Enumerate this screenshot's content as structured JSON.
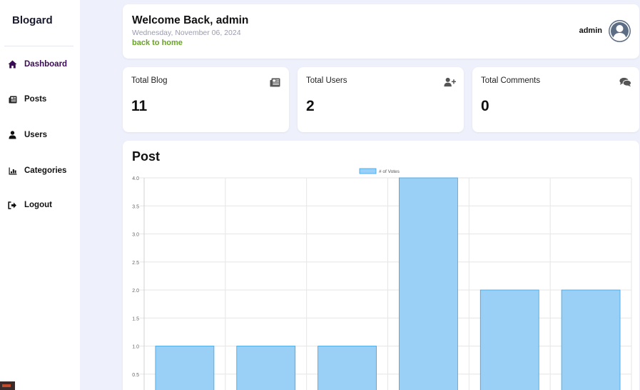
{
  "sidebar": {
    "brand": "Blogard",
    "items": [
      {
        "label": "Dashboard",
        "icon": "home-icon",
        "active": true
      },
      {
        "label": "Posts",
        "icon": "newspaper-icon",
        "active": false
      },
      {
        "label": "Users",
        "icon": "user-icon",
        "active": false
      },
      {
        "label": "Categories",
        "icon": "chart-bar-icon",
        "active": false
      },
      {
        "label": "Logout",
        "icon": "logout-icon",
        "active": false
      }
    ]
  },
  "header": {
    "welcome": "Welcome Back, admin",
    "date": "Wednesday, November 06, 2024",
    "back_link": "back to home",
    "user_name": "admin"
  },
  "stats": [
    {
      "title": "Total Blog",
      "value": "11",
      "icon": "newspaper-icon"
    },
    {
      "title": "Total Users",
      "value": "2",
      "icon": "user-plus-icon"
    },
    {
      "title": "Total Comments",
      "value": "0",
      "icon": "comments-icon"
    }
  ],
  "chart": {
    "title": "Post"
  },
  "colors": {
    "accent": "#3b0a57",
    "link": "#6aa12b",
    "bar_fill": "#9ad0f5",
    "bar_stroke": "#36a2eb",
    "background": "#eef1fb"
  },
  "chart_data": {
    "type": "bar",
    "series": [
      {
        "name": "# of Votes",
        "values": [
          1,
          1,
          1,
          4,
          2,
          2
        ]
      }
    ],
    "yticks": [
      "4.0",
      "3.5",
      "3.0",
      "2.5",
      "2.0",
      "1.5",
      "1.0",
      "0.5"
    ],
    "ylim": [
      0,
      4
    ],
    "grid": true,
    "legend": "top-center"
  }
}
